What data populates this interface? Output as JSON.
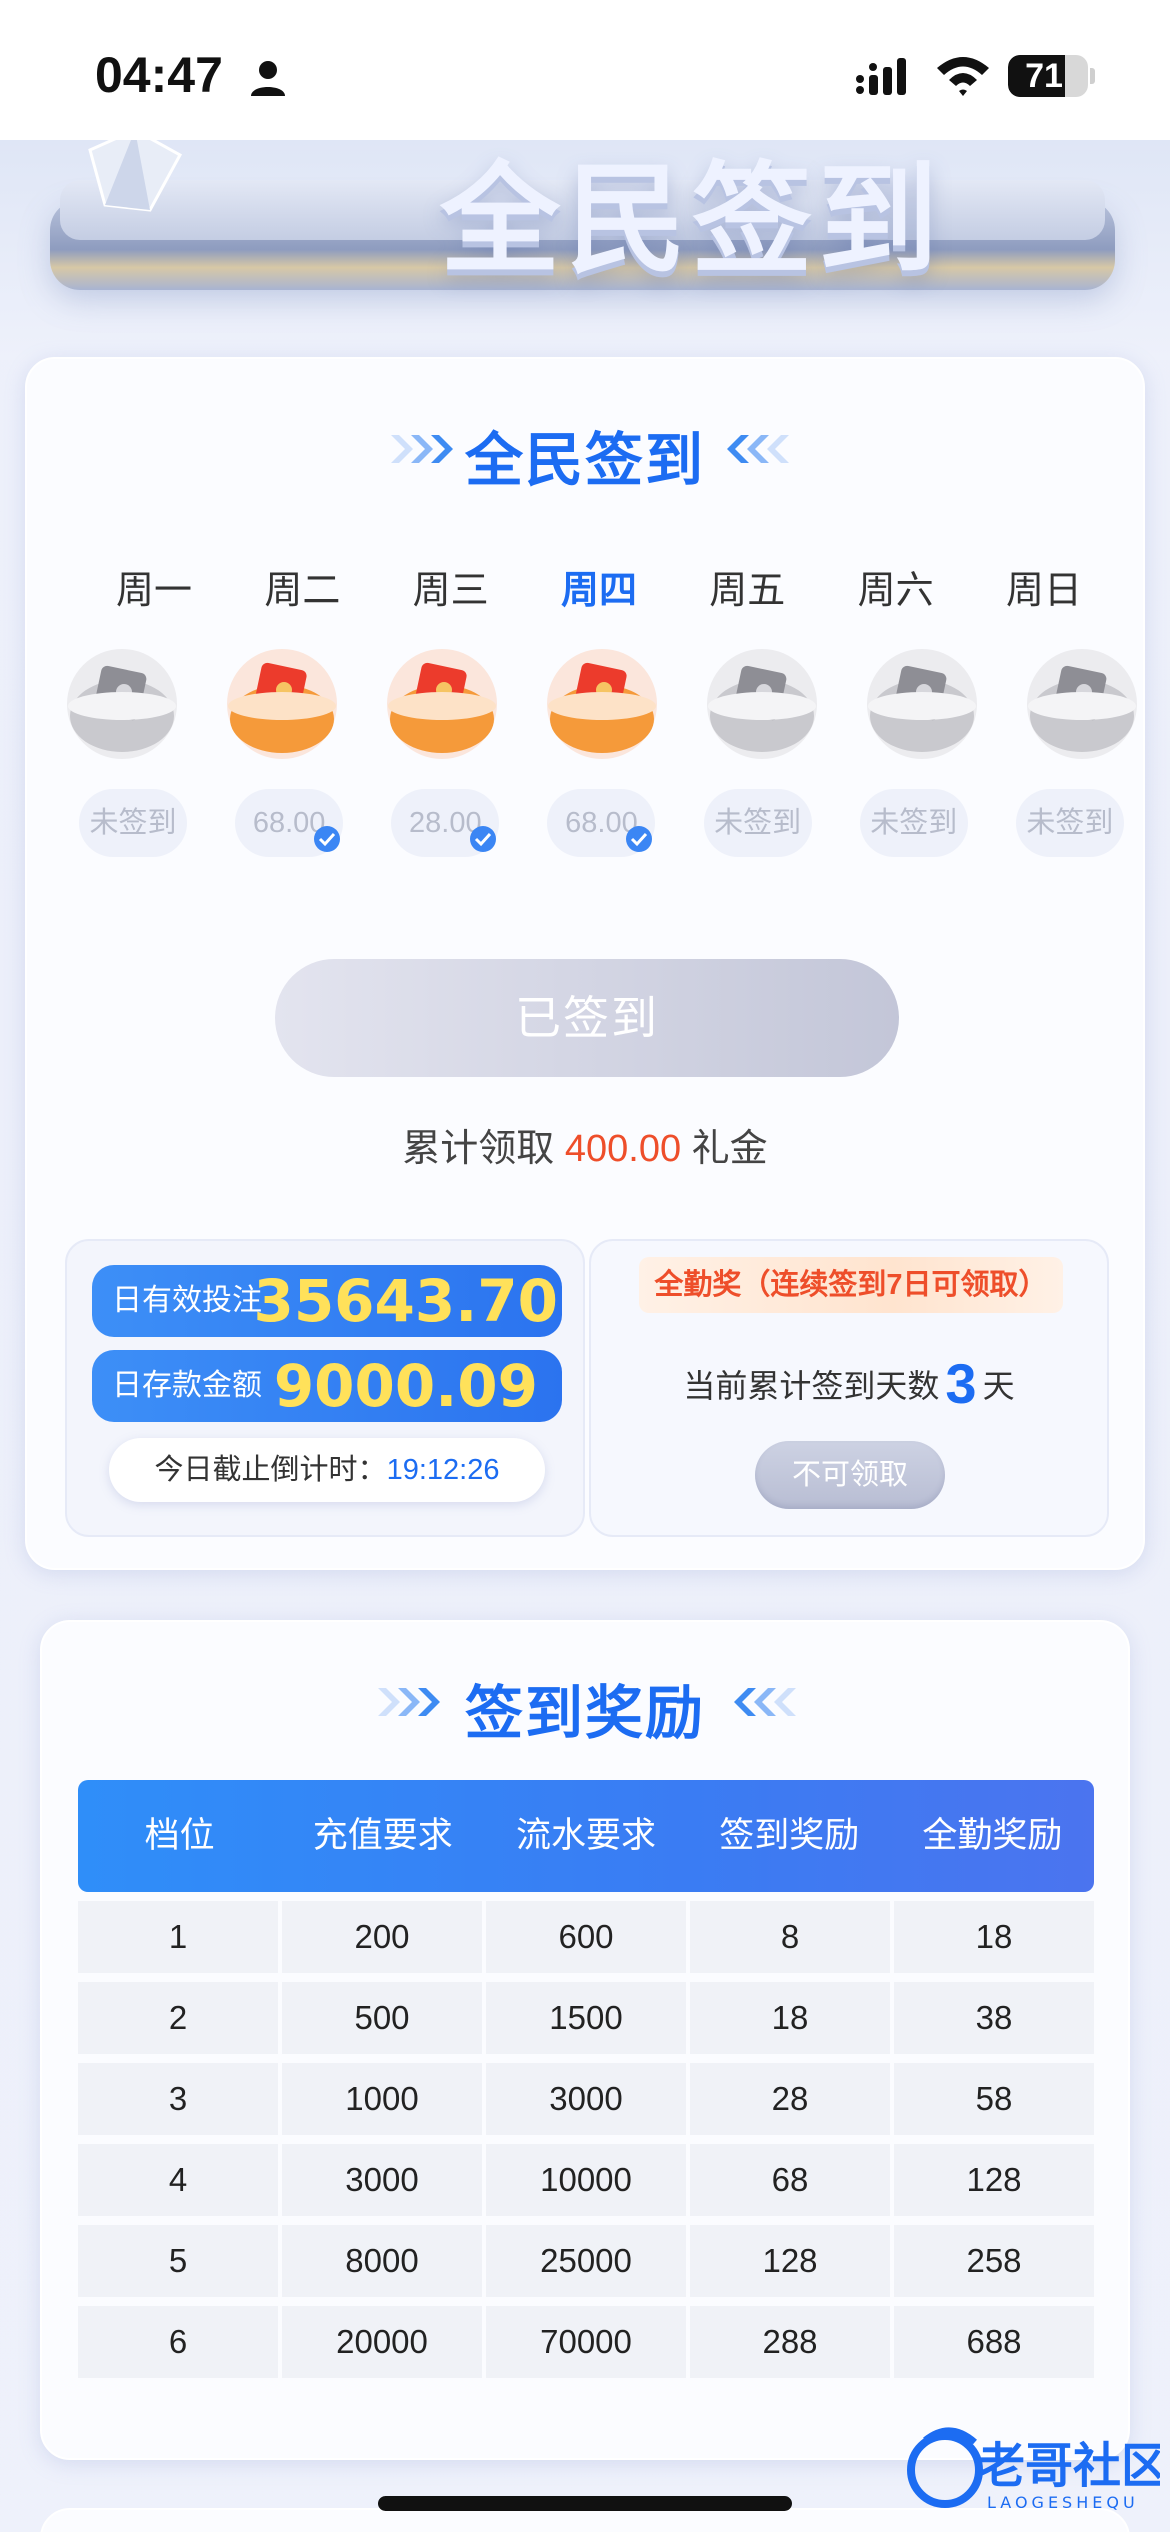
{
  "status_bar": {
    "time": "04:47",
    "battery": "71"
  },
  "hero": {
    "title": "全民签到"
  },
  "signin": {
    "title": "全民签到",
    "days": [
      {
        "label": "周一",
        "status": "未签到",
        "signed": false,
        "active": false
      },
      {
        "label": "周二",
        "status": "68.00",
        "signed": true,
        "active": false
      },
      {
        "label": "周三",
        "status": "28.00",
        "signed": true,
        "active": false
      },
      {
        "label": "周四",
        "status": "68.00",
        "signed": true,
        "active": true
      },
      {
        "label": "周五",
        "status": "未签到",
        "signed": false,
        "active": false
      },
      {
        "label": "周六",
        "status": "未签到",
        "signed": false,
        "active": false
      },
      {
        "label": "周日",
        "status": "未签到",
        "signed": false,
        "active": false
      }
    ],
    "button_label": "已签到",
    "total_prefix": "累计领取",
    "total_amount": "400.00",
    "total_suffix": "礼金",
    "effective_bet_label": "日有效投注",
    "effective_bet_value": "35643.70",
    "deposit_label": "日存款金额",
    "deposit_value": "9000.09",
    "countdown_label": "今日截止倒计时：",
    "countdown_value": "19:12:26",
    "bonus_tag": "全勤奖（连续签到7日可领取）",
    "days_prefix": "当前累计签到天数",
    "days_count": "3",
    "days_suffix": "天",
    "claim_label": "不可领取"
  },
  "rewards": {
    "title": "签到奖励",
    "columns": [
      "档位",
      "充值要求",
      "流水要求",
      "签到奖励",
      "全勤奖励"
    ],
    "rows": [
      [
        "1",
        "200",
        "600",
        "8",
        "18"
      ],
      [
        "2",
        "500",
        "1500",
        "18",
        "38"
      ],
      [
        "3",
        "1000",
        "3000",
        "28",
        "58"
      ],
      [
        "4",
        "3000",
        "10000",
        "68",
        "128"
      ],
      [
        "5",
        "8000",
        "25000",
        "128",
        "258"
      ],
      [
        "6",
        "20000",
        "70000",
        "288",
        "688"
      ]
    ]
  },
  "watermark": {
    "text": "老哥社区",
    "subtext": "LAOGESHEQU"
  },
  "colors": {
    "accent": "#1c6cf2",
    "highlight": "#ee4e2a",
    "stat_value": "#ffe15a"
  }
}
